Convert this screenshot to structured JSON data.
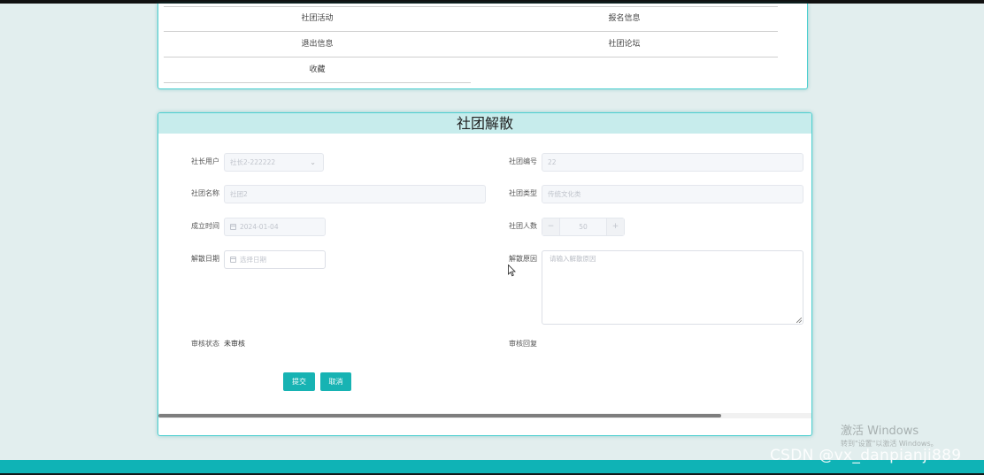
{
  "menu": {
    "items": [
      "社团活动",
      "报名信息",
      "退出信息",
      "社团论坛",
      "收藏"
    ]
  },
  "form": {
    "title": "社团解散",
    "president_user": {
      "label": "社长用户",
      "value": "社长2-222222"
    },
    "club_no": {
      "label": "社团编号",
      "value": "22"
    },
    "club_name": {
      "label": "社团名称",
      "value": "社团2"
    },
    "club_type": {
      "label": "社团类型",
      "value": "传统文化类"
    },
    "founded": {
      "label": "成立时间",
      "value": "2024-01-04"
    },
    "members": {
      "label": "社团人数",
      "value": "50",
      "minus": "−",
      "plus": "+"
    },
    "dissolve_date": {
      "label": "解散日期",
      "placeholder": "选择日期"
    },
    "dissolve_reason": {
      "label": "解散原因",
      "placeholder": "请输入解散原因"
    },
    "review_status": {
      "label": "审核状态",
      "value": "未审核"
    },
    "review_reply": {
      "label": "审核回复"
    },
    "submit_label": "提交",
    "cancel_label": "取消"
  },
  "watermark": {
    "title": "激活 Windows",
    "subtitle": "转到\"设置\"以激活 Windows。",
    "csdn": "CSDN @vx_danpianji889"
  },
  "colors": {
    "accent": "#17b3b3",
    "header_bg": "#c7ecec",
    "page_bg": "#e2eeee"
  }
}
